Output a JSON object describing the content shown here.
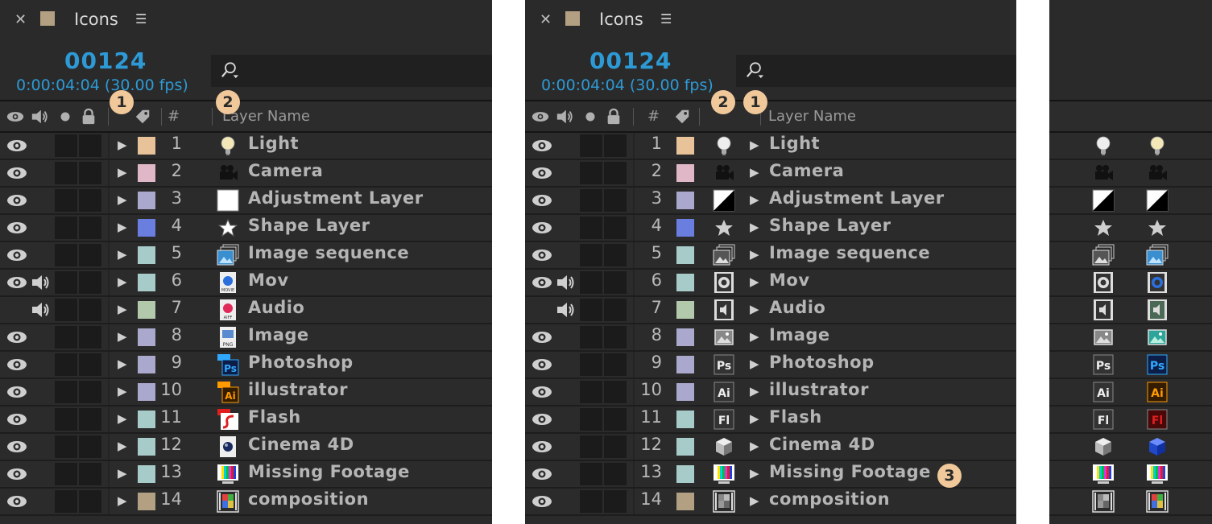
{
  "panel": {
    "tab_title": "Icons",
    "timecode": "00124",
    "time_fps": "0:00:04:04 (30.00 fps)",
    "tab_color": "#b3a083"
  },
  "header": {
    "num_col": "#",
    "layer_name_col": "Layer Name"
  },
  "badges": {
    "one": "1",
    "two": "2",
    "three": "3"
  },
  "layers": [
    {
      "num": "1",
      "name": "Light",
      "label": "#e8c39a",
      "video": true,
      "audio": false,
      "icon": "light-icon"
    },
    {
      "num": "2",
      "name": "Camera",
      "label": "#e0b7c6",
      "video": true,
      "audio": false,
      "icon": "camera-icon"
    },
    {
      "num": "3",
      "name": "Adjustment Layer",
      "label": "#aaa8cc",
      "video": true,
      "audio": false,
      "icon": "adjustment-icon"
    },
    {
      "num": "4",
      "name": "Shape Layer",
      "label": "#6a7ee0",
      "video": true,
      "audio": false,
      "icon": "star-icon"
    },
    {
      "num": "5",
      "name": "Image sequence",
      "label": "#a7cbc9",
      "video": true,
      "audio": false,
      "icon": "image-sequence-icon"
    },
    {
      "num": "6",
      "name": "Mov",
      "label": "#a7cbc9",
      "video": true,
      "audio": true,
      "icon": "mov-icon"
    },
    {
      "num": "7",
      "name": "Audio",
      "label": "#b3c9ab",
      "video": false,
      "audio": true,
      "icon": "audio-icon"
    },
    {
      "num": "8",
      "name": "Image",
      "label": "#aaa8cc",
      "video": true,
      "audio": false,
      "icon": "image-icon"
    },
    {
      "num": "9",
      "name": "Photoshop",
      "label": "#aaa8cc",
      "video": true,
      "audio": false,
      "icon": "photoshop-icon"
    },
    {
      "num": "10",
      "name": "illustrator",
      "label": "#aaa8cc",
      "video": true,
      "audio": false,
      "icon": "illustrator-icon"
    },
    {
      "num": "11",
      "name": "Flash",
      "label": "#a7cbc9",
      "video": true,
      "audio": false,
      "icon": "flash-icon"
    },
    {
      "num": "12",
      "name": "Cinema 4D",
      "label": "#a7cbc9",
      "video": true,
      "audio": false,
      "icon": "cinema4d-icon"
    },
    {
      "num": "13",
      "name": "Missing Footage",
      "label": "#a7cbc9",
      "video": true,
      "audio": false,
      "icon": "missing-footage-icon"
    },
    {
      "num": "14",
      "name": "composition",
      "label": "#b3a083",
      "video": true,
      "audio": false,
      "icon": "composition-icon"
    }
  ]
}
